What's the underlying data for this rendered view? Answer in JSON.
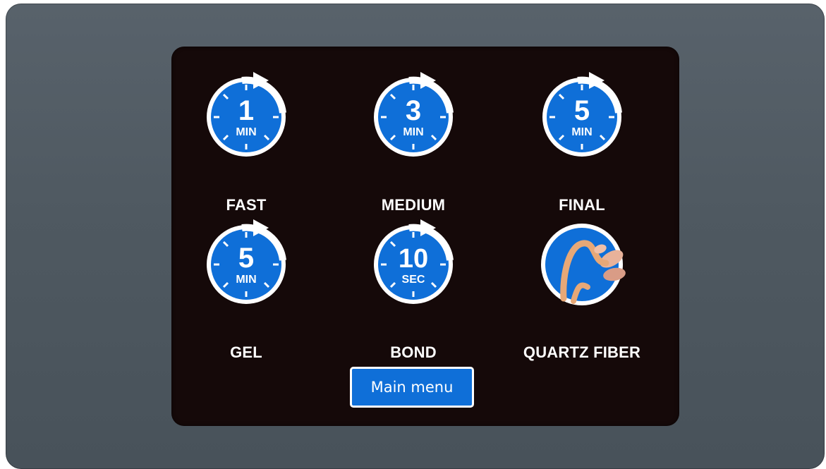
{
  "tiles": [
    {
      "number": "1",
      "unit": "MIN",
      "label": "FAST"
    },
    {
      "number": "3",
      "unit": "MIN",
      "label": "MEDIUM"
    },
    {
      "number": "5",
      "unit": "MIN",
      "label": "FINAL"
    },
    {
      "number": "5",
      "unit": "MIN",
      "label": "GEL"
    },
    {
      "number": "10",
      "unit": "SEC",
      "label": "BOND"
    },
    {
      "icon": "quartz-fiber-photo-icon",
      "label": "QUARTZ FIBER"
    }
  ],
  "main_menu_label": "Main menu",
  "colors": {
    "bezel": "#515b64",
    "screen": "#150909",
    "accent_blue": "#0f6fd8",
    "text": "#ffffff"
  }
}
